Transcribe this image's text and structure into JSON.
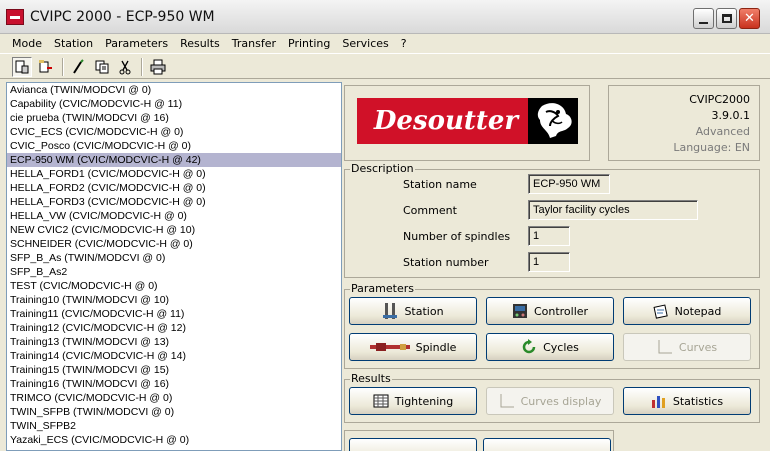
{
  "window": {
    "title": "CVIPC 2000 - ECP-950 WM"
  },
  "menu": [
    "Mode",
    "Station",
    "Parameters",
    "Results",
    "Transfer",
    "Printing",
    "Services",
    "?"
  ],
  "toolbar": [
    "station-icon",
    "station-connect-icon",
    "edit-icon",
    "copy-icon",
    "cut-icon",
    "print-icon"
  ],
  "stations": [
    "Avianca (TWIN/MODCVI @ 0)",
    "Capability (CVIC/MODCVIC-H @ 11)",
    "cie prueba (TWIN/MODCVI @ 16)",
    "CVIC_ECS (CVIC/MODCVIC-H @ 0)",
    "CVIC_Posco (CVIC/MODCVIC-H @ 0)",
    "ECP-950 WM (CVIC/MODCVIC-H @ 42)",
    "HELLA_FORD1 (CVIC/MODCVIC-H @ 0)",
    "HELLA_FORD2 (CVIC/MODCVIC-H @ 0)",
    "HELLA_FORD3 (CVIC/MODCVIC-H @ 0)",
    "HELLA_VW (CVIC/MODCVIC-H @ 0)",
    "NEW CVIC2 (CVIC/MODCVIC-H @ 10)",
    "SCHNEIDER (CVIC/MODCVIC-H @ 0)",
    "SFP_B_As (TWIN/MODCVI @ 0)",
    "SFP_B_As2",
    "TEST (CVIC/MODCVIC-H @ 0)",
    "Training10 (TWIN/MODCVI @ 10)",
    "Training11 (CVIC/MODCVIC-H @ 11)",
    "Training12 (CVIC/MODCVIC-H @ 12)",
    "Training13 (TWIN/MODCVI @ 13)",
    "Training14 (CVIC/MODCVIC-H @ 14)",
    "Training15 (TWIN/MODCVI @ 15)",
    "Training16 (TWIN/MODCVI @ 16)",
    "TRIMCO (CVIC/MODCVIC-H @ 0)",
    "TWIN_SFPB (TWIN/MODCVI @ 0)",
    "TWIN_SFPB2",
    "Yazaki_ECS (CVIC/MODCVIC-H @ 0)"
  ],
  "selected_station": "ECP-950 WM (CVIC/MODCVIC-H @ 42)",
  "logo": {
    "brand": "Desoutter"
  },
  "version": {
    "product": "CVIPC2000",
    "number": "3.9.0.1",
    "edition": "Advanced",
    "language": "Language: EN"
  },
  "description": {
    "label": "Description",
    "station_name_label": "Station name",
    "station_name": "ECP-950 WM",
    "comment_label": "Comment",
    "comment": "Taylor facility cycles",
    "spindles_label": "Number of spindles",
    "spindles": "1",
    "station_number_label": "Station number",
    "station_number": "1"
  },
  "parameters": {
    "label": "Parameters",
    "station": "Station",
    "controller": "Controller",
    "notepad": "Notepad",
    "spindle": "Spindle",
    "cycles": "Cycles",
    "curves": "Curves"
  },
  "results": {
    "label": "Results",
    "tightening": "Tightening",
    "curves_display": "Curves display",
    "statistics": "Statistics"
  },
  "colors": {
    "brand_red": "#d01128",
    "selection": "#b4b4d0",
    "window_bg": "#ece9d8"
  }
}
